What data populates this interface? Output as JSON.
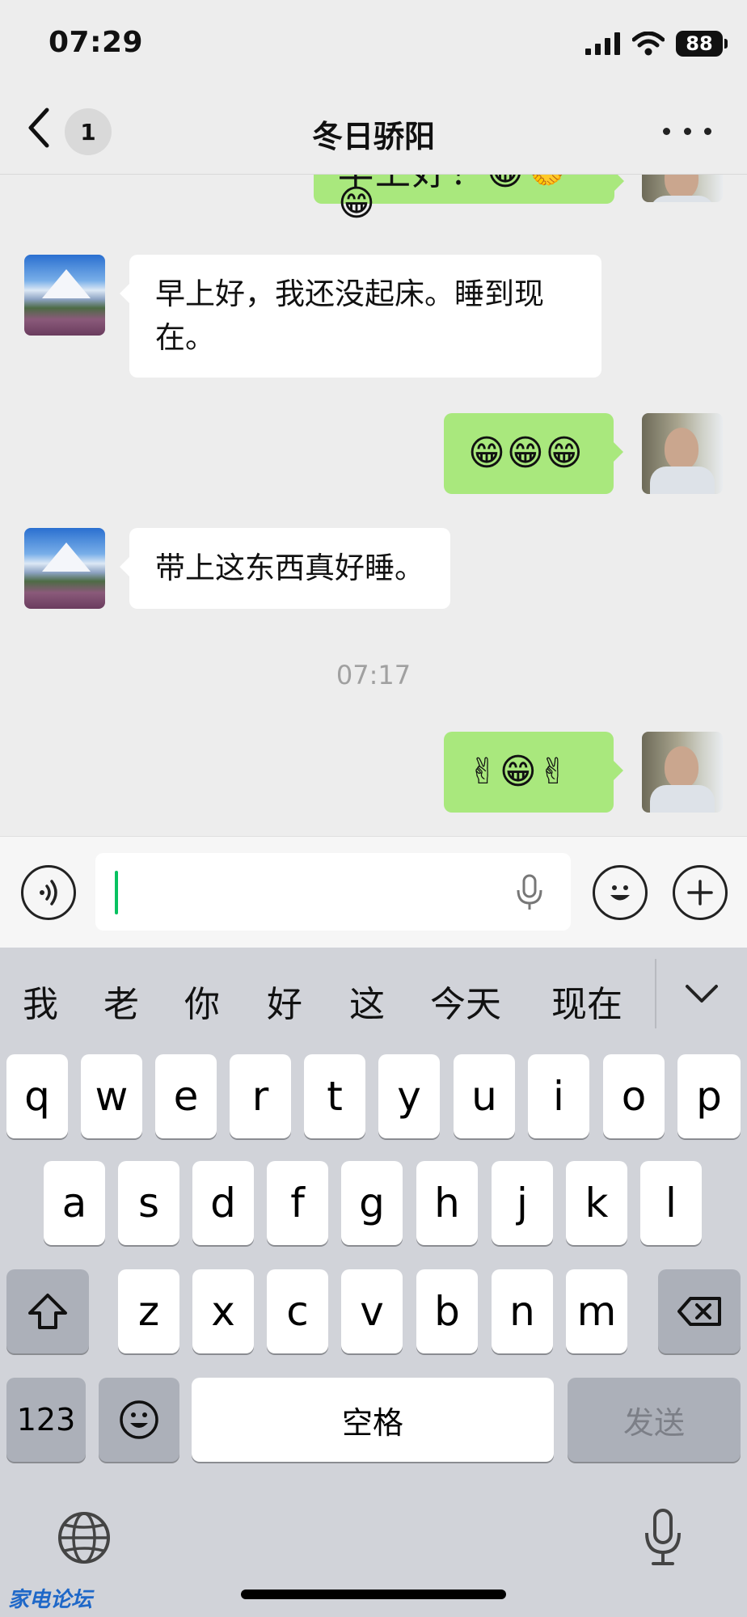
{
  "status_bar": {
    "time": "07:29",
    "battery": "88",
    "icons": [
      "signal-icon",
      "wifi-icon"
    ]
  },
  "header": {
    "back_icon": "chevron-left-icon",
    "unread_count": "1",
    "title": "冬日骄阳",
    "more_icon": "more-icon"
  },
  "messages": [
    {
      "side": "out",
      "text": "早上好！😁🤝😁",
      "partial": true
    },
    {
      "side": "in",
      "text": "早上好，我还没起床。睡到现在。"
    },
    {
      "side": "out",
      "text": "😁😁😁"
    },
    {
      "side": "in",
      "text": "带上这东西真好睡。"
    },
    {
      "side": "out",
      "text": "✌😁✌"
    }
  ],
  "timestamp": "07:17",
  "input_bar": {
    "voice_icon": "voice-mode-icon",
    "mic_icon": "microphone-icon",
    "emoji_icon": "emoji-icon",
    "plus_icon": "plus-icon",
    "value": ""
  },
  "keyboard": {
    "candidates": [
      "我",
      "老",
      "你",
      "好",
      "这",
      "今天",
      "现在"
    ],
    "collapse_icon": "chevron-down-icon",
    "row1": [
      "q",
      "w",
      "e",
      "r",
      "t",
      "y",
      "u",
      "i",
      "o",
      "p"
    ],
    "row2": [
      "a",
      "s",
      "d",
      "f",
      "g",
      "h",
      "j",
      "k",
      "l"
    ],
    "row3": [
      "z",
      "x",
      "c",
      "v",
      "b",
      "n",
      "m"
    ],
    "shift_icon": "shift-icon",
    "delete_icon": "delete-icon",
    "numbers_label": "123",
    "emoji_key_icon": "emoji-icon",
    "space_label": "空格",
    "send_label": "发送",
    "globe_icon": "globe-icon",
    "dictation_icon": "microphone-icon"
  },
  "watermark": "家电论坛",
  "colors": {
    "outgoing_bubble": "#a9e87d",
    "incoming_bubble": "#ffffff",
    "background": "#ededed",
    "caret": "#07c160"
  }
}
